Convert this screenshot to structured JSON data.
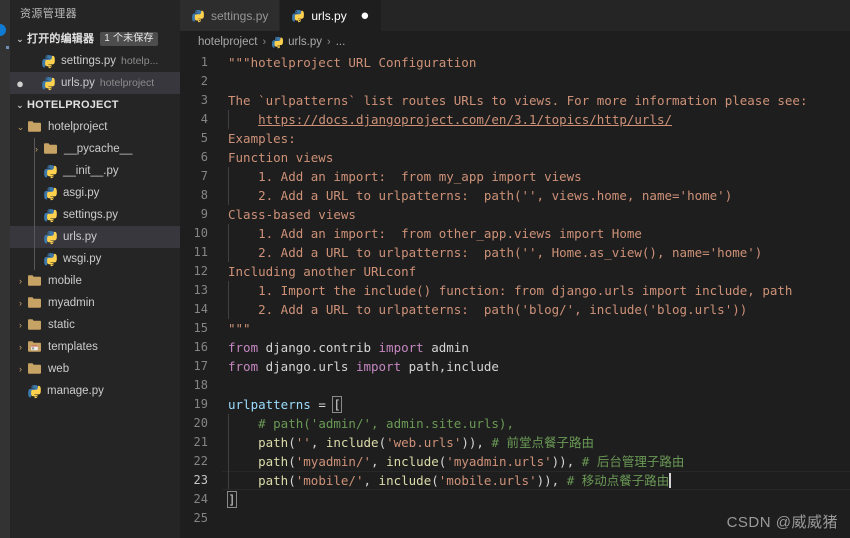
{
  "window": {
    "app": "Visual Studio Code"
  },
  "activitybar": {
    "badge_label": ""
  },
  "sidebar": {
    "title": "资源管理器",
    "open_editors": {
      "label": "打开的编辑器",
      "unsaved_badge": "1 个未保存",
      "twisty": "⌄",
      "items": [
        {
          "name": "settings.py",
          "path": "hotelp...",
          "dirty": false,
          "selected": false,
          "icon": "python-icon"
        },
        {
          "name": "urls.py",
          "path": "hotelproject",
          "dirty": true,
          "selected": true,
          "icon": "python-icon"
        }
      ]
    },
    "workspace": {
      "label": "HOTELPROJECT",
      "twisty": "⌄",
      "tree": [
        {
          "label": "hotelproject",
          "type": "folder",
          "depth": 1,
          "expanded": true,
          "arrow": "⌄",
          "selected": false
        },
        {
          "label": "__pycache__",
          "type": "folder",
          "depth": 2,
          "expanded": false,
          "arrow": "›",
          "selected": false
        },
        {
          "label": "__init__.py",
          "type": "python",
          "depth": 2,
          "expanded": null,
          "arrow": "",
          "selected": false
        },
        {
          "label": "asgi.py",
          "type": "python",
          "depth": 2,
          "expanded": null,
          "arrow": "",
          "selected": false
        },
        {
          "label": "settings.py",
          "type": "python",
          "depth": 2,
          "expanded": null,
          "arrow": "",
          "selected": false
        },
        {
          "label": "urls.py",
          "type": "python",
          "depth": 2,
          "expanded": null,
          "arrow": "",
          "selected": true
        },
        {
          "label": "wsgi.py",
          "type": "python",
          "depth": 2,
          "expanded": null,
          "arrow": "",
          "selected": false
        },
        {
          "label": "mobile",
          "type": "folder",
          "depth": 1,
          "expanded": false,
          "arrow": "›",
          "selected": false
        },
        {
          "label": "myadmin",
          "type": "folder",
          "depth": 1,
          "expanded": false,
          "arrow": "›",
          "selected": false
        },
        {
          "label": "static",
          "type": "folder",
          "depth": 1,
          "expanded": false,
          "arrow": "›",
          "selected": false
        },
        {
          "label": "templates",
          "type": "folder-template",
          "depth": 1,
          "expanded": false,
          "arrow": "›",
          "selected": false
        },
        {
          "label": "web",
          "type": "folder",
          "depth": 1,
          "expanded": false,
          "arrow": "›",
          "selected": false
        },
        {
          "label": "manage.py",
          "type": "python",
          "depth": 1,
          "expanded": null,
          "arrow": "",
          "selected": false
        }
      ]
    }
  },
  "tabs": [
    {
      "label": "settings.py",
      "active": false,
      "dirty": false,
      "icon": "python-icon"
    },
    {
      "label": "urls.py",
      "active": true,
      "dirty": true,
      "icon": "python-icon",
      "dirty_glyph": "●"
    }
  ],
  "breadcrumb": {
    "parts": [
      "hotelproject",
      "urls.py",
      "..."
    ],
    "separator": "›"
  },
  "editor": {
    "active_line": 23,
    "first_line": 1,
    "last_line": 25,
    "lines": [
      {
        "n": 1,
        "guides": 0,
        "tokens": [
          {
            "c": "str",
            "t": "\"\"\"hotelproject URL Configuration"
          }
        ]
      },
      {
        "n": 2,
        "guides": 0,
        "tokens": []
      },
      {
        "n": 3,
        "guides": 0,
        "tokens": [
          {
            "c": "str",
            "t": "The `urlpatterns` list routes URLs to views. For more information please see:"
          }
        ]
      },
      {
        "n": 4,
        "guides": 1,
        "tokens": [
          {
            "c": "plain",
            "t": "    "
          },
          {
            "c": "link",
            "t": "https://docs.djangoproject.com/en/3.1/topics/http/urls/"
          }
        ]
      },
      {
        "n": 5,
        "guides": 0,
        "tokens": [
          {
            "c": "str",
            "t": "Examples:"
          }
        ]
      },
      {
        "n": 6,
        "guides": 0,
        "tokens": [
          {
            "c": "str",
            "t": "Function views"
          }
        ]
      },
      {
        "n": 7,
        "guides": 1,
        "tokens": [
          {
            "c": "str",
            "t": "    1. Add an import:  from my_app import views"
          }
        ]
      },
      {
        "n": 8,
        "guides": 1,
        "tokens": [
          {
            "c": "str",
            "t": "    2. Add a URL to urlpatterns:  path('', views.home, name='home')"
          }
        ]
      },
      {
        "n": 9,
        "guides": 0,
        "tokens": [
          {
            "c": "str",
            "t": "Class-based views"
          }
        ]
      },
      {
        "n": 10,
        "guides": 1,
        "tokens": [
          {
            "c": "str",
            "t": "    1. Add an import:  from other_app.views import Home"
          }
        ]
      },
      {
        "n": 11,
        "guides": 1,
        "tokens": [
          {
            "c": "str",
            "t": "    2. Add a URL to urlpatterns:  path('', Home.as_view(), name='home')"
          }
        ]
      },
      {
        "n": 12,
        "guides": 0,
        "tokens": [
          {
            "c": "str",
            "t": "Including another URLconf"
          }
        ]
      },
      {
        "n": 13,
        "guides": 1,
        "tokens": [
          {
            "c": "str",
            "t": "    1. Import the include() function: from django.urls import include, path"
          }
        ]
      },
      {
        "n": 14,
        "guides": 1,
        "tokens": [
          {
            "c": "str",
            "t": "    2. Add a URL to urlpatterns:  path('blog/', include('blog.urls'))"
          }
        ]
      },
      {
        "n": 15,
        "guides": 0,
        "tokens": [
          {
            "c": "str",
            "t": "\"\"\""
          }
        ]
      },
      {
        "n": 16,
        "guides": 0,
        "tokens": [
          {
            "c": "kw",
            "t": "from"
          },
          {
            "c": "plain",
            "t": " django.contrib "
          },
          {
            "c": "kw",
            "t": "import"
          },
          {
            "c": "plain",
            "t": " admin"
          }
        ]
      },
      {
        "n": 17,
        "guides": 0,
        "tokens": [
          {
            "c": "kw",
            "t": "from"
          },
          {
            "c": "plain",
            "t": " django.urls "
          },
          {
            "c": "kw",
            "t": "import"
          },
          {
            "c": "plain",
            "t": " path,include"
          }
        ]
      },
      {
        "n": 18,
        "guides": 0,
        "tokens": []
      },
      {
        "n": 19,
        "guides": 0,
        "tokens": [
          {
            "c": "var",
            "t": "urlpatterns"
          },
          {
            "c": "plain",
            "t": " = "
          },
          {
            "c": "brk-box",
            "t": "["
          }
        ]
      },
      {
        "n": 20,
        "guides": 1,
        "tokens": [
          {
            "c": "plain",
            "t": "    "
          },
          {
            "c": "com",
            "t": "# path('admin/', admin.site.urls),"
          }
        ]
      },
      {
        "n": 21,
        "guides": 1,
        "tokens": [
          {
            "c": "plain",
            "t": "    "
          },
          {
            "c": "fn",
            "t": "path"
          },
          {
            "c": "plain",
            "t": "("
          },
          {
            "c": "str",
            "t": "''"
          },
          {
            "c": "plain",
            "t": ", "
          },
          {
            "c": "fn",
            "t": "include"
          },
          {
            "c": "plain",
            "t": "("
          },
          {
            "c": "str",
            "t": "'web.urls'"
          },
          {
            "c": "plain",
            "t": ")), "
          },
          {
            "c": "com",
            "t": "# 前堂点餐子路由"
          }
        ]
      },
      {
        "n": 22,
        "guides": 1,
        "tokens": [
          {
            "c": "plain",
            "t": "    "
          },
          {
            "c": "fn",
            "t": "path"
          },
          {
            "c": "plain",
            "t": "("
          },
          {
            "c": "str",
            "t": "'myadmin/'"
          },
          {
            "c": "plain",
            "t": ", "
          },
          {
            "c": "fn",
            "t": "include"
          },
          {
            "c": "plain",
            "t": "("
          },
          {
            "c": "str",
            "t": "'myadmin.urls'"
          },
          {
            "c": "plain",
            "t": ")), "
          },
          {
            "c": "com",
            "t": "# 后台管理子路由"
          }
        ]
      },
      {
        "n": 23,
        "guides": 1,
        "tokens": [
          {
            "c": "plain",
            "t": "    "
          },
          {
            "c": "fn",
            "t": "path"
          },
          {
            "c": "plain",
            "t": "("
          },
          {
            "c": "str",
            "t": "'mobile/'"
          },
          {
            "c": "plain",
            "t": ", "
          },
          {
            "c": "fn",
            "t": "include"
          },
          {
            "c": "plain",
            "t": "("
          },
          {
            "c": "str",
            "t": "'mobile.urls'"
          },
          {
            "c": "plain",
            "t": ")), "
          },
          {
            "c": "com",
            "t": "# 移动点餐子路由"
          },
          {
            "c": "cursor",
            "t": ""
          }
        ]
      },
      {
        "n": 24,
        "guides": 0,
        "tokens": [
          {
            "c": "brk-box",
            "t": "]"
          }
        ]
      },
      {
        "n": 25,
        "guides": 0,
        "tokens": []
      }
    ]
  },
  "watermark": {
    "text": "CSDN @威威猪"
  },
  "colors": {
    "editor_bg": "#1e1e1e",
    "sidebar_bg": "#252526",
    "tab_inactive_bg": "#2d2d2d",
    "selection_bg": "#37373d",
    "string": "#ce9178",
    "comment": "#6a9955",
    "keyword": "#c586c0",
    "function": "#dcdcaa",
    "variable": "#9cdcfe",
    "line_number": "#858585",
    "accent_blue": "#0f7bd4",
    "folder_gold": "#c6a264"
  }
}
